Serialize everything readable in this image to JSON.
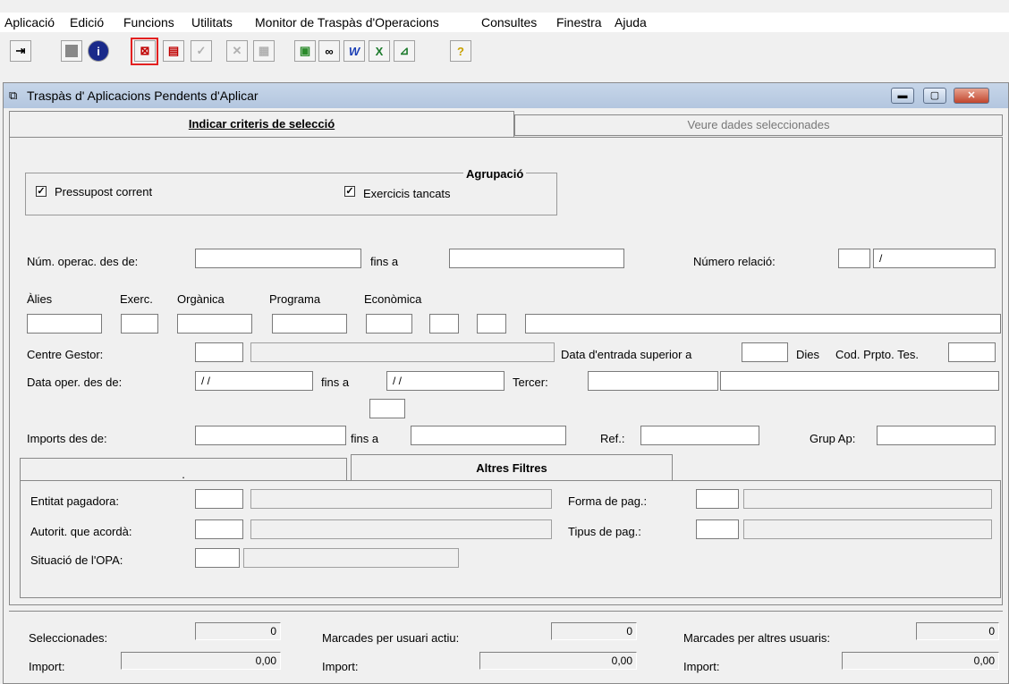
{
  "menu": [
    "Aplicació",
    "Edició",
    "Funcions",
    "Utilitats",
    "Monitor de Traspàs d'Operacions",
    "Consultes",
    "Finestra",
    "Ajuda"
  ],
  "window": {
    "title": "Traspàs d' Aplicacions Pendents d'Aplicar"
  },
  "tabs": {
    "criteria": "Indicar criteris de selecció",
    "data": "Veure dades seleccionades"
  },
  "grouping": {
    "title": "Agrupació",
    "current_budget": "Pressupost corrent",
    "closed_years": "Exercicis tancats"
  },
  "labels": {
    "op_from": "Núm. operac. des de:",
    "op_to": "fins a",
    "relation_number": "Número relació:",
    "alias": "Àlies",
    "exercise": "Exerc.",
    "organic": "Orgànica",
    "program": "Programa",
    "economic": "Econòmica",
    "center": "Centre Gestor:",
    "entry_date": "Data d'entrada superior a",
    "days": "Dies",
    "cod": "Cod. Prpto. Tes.",
    "date_from": "Data oper. des de:",
    "date_to": "fins a",
    "third": "Tercer:",
    "amount_from": "Imports des de:",
    "amount_to": "fins a",
    "ref": "Ref.:",
    "group": "Grup Ap:"
  },
  "values": {
    "relation_number": "/",
    "date_from": "/ /",
    "date_to": "/ /"
  },
  "subtabs": {
    "first": ".",
    "second": "Altres Filtres"
  },
  "filters": {
    "payer": "Entitat pagadora:",
    "authority": "Autorit. que acordà:",
    "status": "Situació de l'OPA:",
    "pay_form": "Forma de pag.:",
    "pay_type": "Tipus de pag.:"
  },
  "summary": {
    "selected": "Seleccionades:",
    "selected_value": "0",
    "marked_active": "Marcades per usuari actiu:",
    "marked_active_value": "0",
    "marked_others": "Marcades per altres usuaris:",
    "marked_others_value": "0",
    "amount_label": "Import:",
    "amount1": "0,00",
    "amount2": "0,00",
    "amount3": "0,00"
  },
  "colors": {
    "highlight": "#e32020",
    "title_bar": "#b9cbe2"
  }
}
